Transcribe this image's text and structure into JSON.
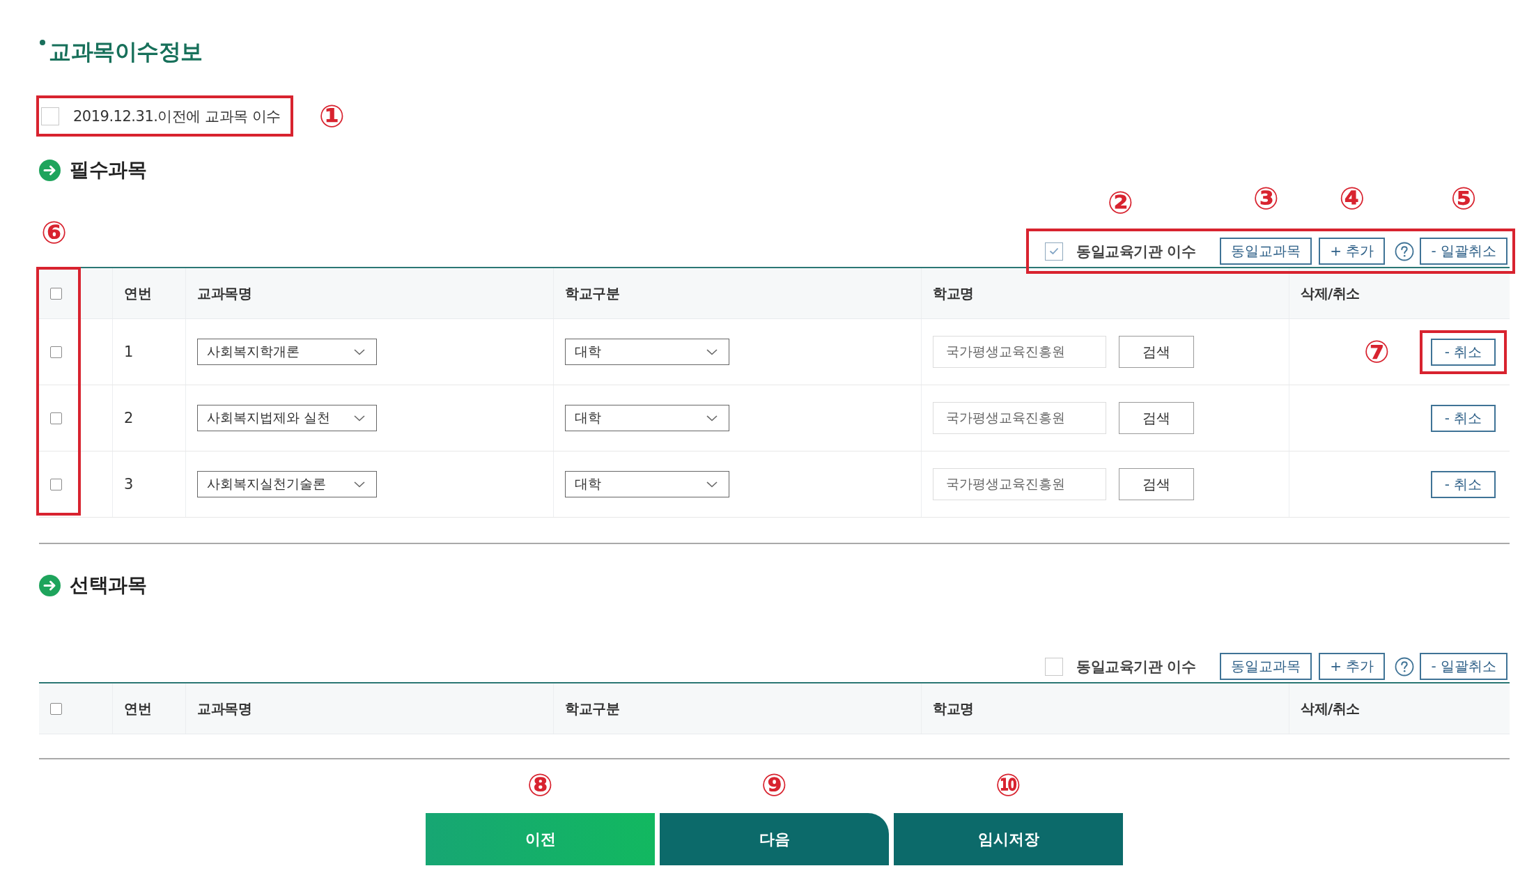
{
  "page_title": "교과목이수정보",
  "pre_2020_option": {
    "label": "2019.12.31.이전에 교과목 이수",
    "checked": false,
    "highlighted": true,
    "callout": "①"
  },
  "sections": [
    {
      "heading": "필수과목",
      "toolbar": {
        "highlighted": true,
        "same_institution": {
          "label": "동일교육기관 이수",
          "checked": true,
          "callout": "②"
        },
        "same_subject_button": {
          "label": "동일교과목",
          "callout": "③"
        },
        "add_button": {
          "label": "+ 추가",
          "callout": "④"
        },
        "cancel_all_button": {
          "label": "- 일괄취소",
          "callout": "⑤"
        }
      },
      "table": {
        "select_all": {
          "checked": false
        },
        "select_column_highlighted": true,
        "select_column_callout": "⑥",
        "columns": [
          "연번",
          "교과목명",
          "학교구분",
          "학교명",
          "삭제/취소"
        ],
        "rows": [
          {
            "checked": false,
            "number": "1",
            "subject": "사회복지학개론",
            "school_type": "대학",
            "school_name": "국가평생교육진흥원",
            "search_button": "검색",
            "cancel_button": "- 취소",
            "cancel_highlighted": true,
            "callout": "⑦"
          },
          {
            "checked": false,
            "number": "2",
            "subject": "사회복지법제와 실천",
            "school_type": "대학",
            "school_name": "국가평생교육진흥원",
            "search_button": "검색",
            "cancel_button": "- 취소"
          },
          {
            "checked": false,
            "number": "3",
            "subject": "사회복지실천기술론",
            "school_type": "대학",
            "school_name": "국가평생교육진흥원",
            "search_button": "검색",
            "cancel_button": "- 취소"
          }
        ]
      }
    },
    {
      "heading": "선택과목",
      "toolbar": {
        "same_institution": {
          "label": "동일교육기관 이수",
          "checked": false
        },
        "same_subject_button": {
          "label": "동일교과목"
        },
        "add_button": {
          "label": "+ 추가"
        },
        "cancel_all_button": {
          "label": "- 일괄취소"
        }
      },
      "table": {
        "select_all": {
          "checked": false
        },
        "columns": [
          "연번",
          "교과목명",
          "학교구분",
          "학교명",
          "삭제/취소"
        ]
      }
    }
  ],
  "footer_buttons": [
    {
      "kind": "back",
      "label": "이전",
      "callout": "⑧"
    },
    {
      "kind": "next",
      "label": "다음",
      "callout": "⑨"
    },
    {
      "kind": "save",
      "label": "임시저장",
      "callout": "⑩"
    }
  ]
}
